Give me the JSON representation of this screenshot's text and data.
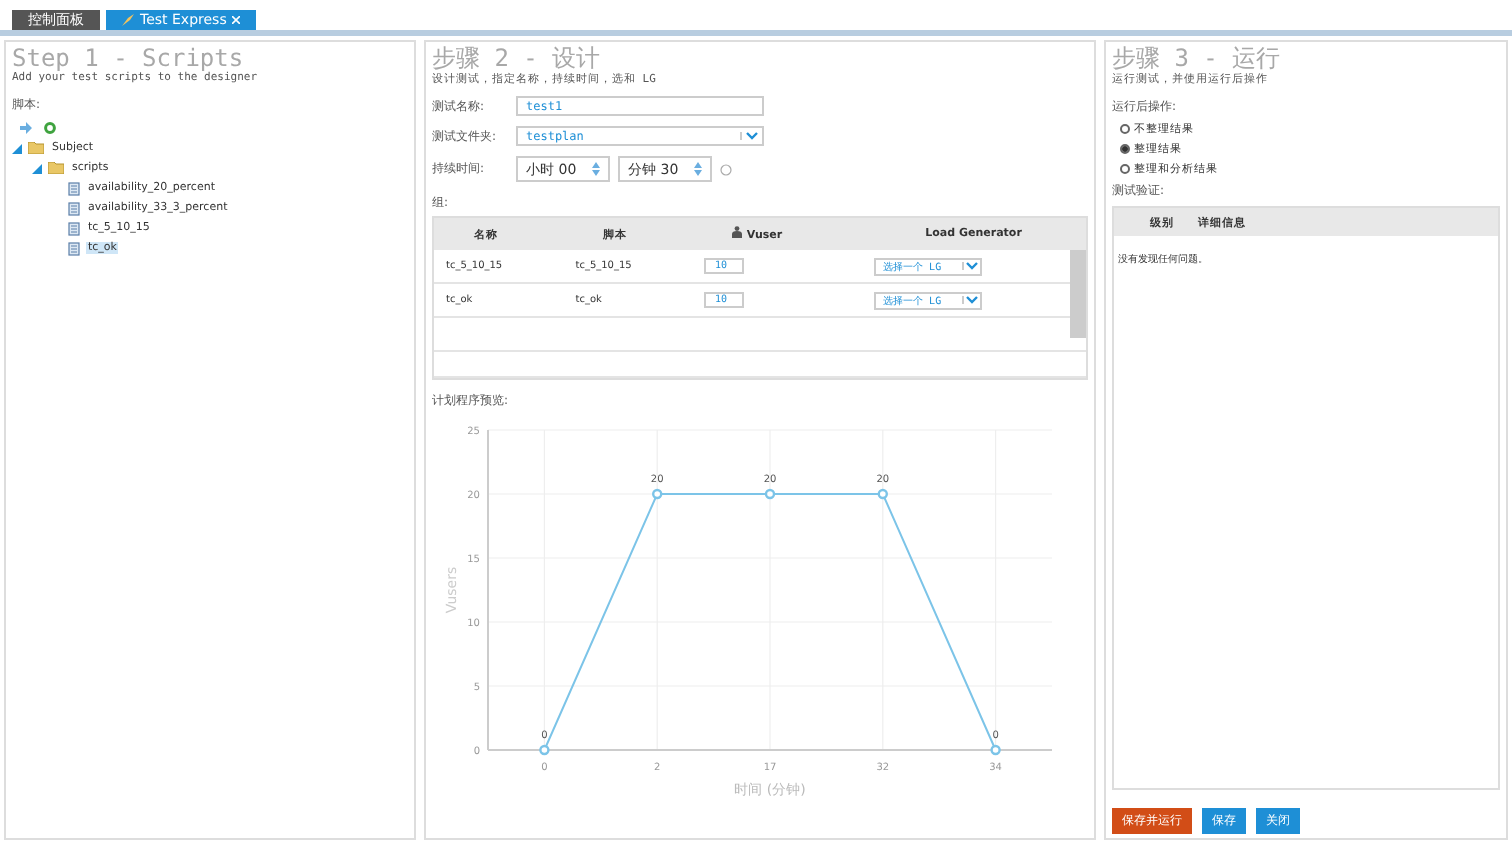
{
  "tabs": [
    {
      "label": "控制面板",
      "selected": false,
      "closable": false
    },
    {
      "label": "Test Express",
      "selected": true,
      "closable": true
    }
  ],
  "step1": {
    "title": "Step 1 - Scripts",
    "subtitle": "Add your test scripts to the designer",
    "scripts_label": "脚本:",
    "tree": [
      {
        "label": "Subject",
        "kind": "folder",
        "expanded": true,
        "selected": false,
        "children": [
          {
            "label": "scripts",
            "kind": "folder",
            "expanded": true,
            "selected": false,
            "children": [
              {
                "label": "availability_20_percent",
                "kind": "script",
                "selected": false
              },
              {
                "label": "availability_33_3_percent",
                "kind": "script",
                "selected": false
              },
              {
                "label": "tc_5_10_15",
                "kind": "script",
                "selected": false
              },
              {
                "label": "tc_ok",
                "kind": "script",
                "selected": true
              }
            ]
          }
        ]
      }
    ]
  },
  "step2": {
    "title": "步骤 2 - 设计",
    "subtitle": "设计测试，指定名称，持续时间，选和 LG",
    "name_label": "测试名称:",
    "name_value": "test1",
    "folder_label": "测试文件夹:",
    "folder_value": "testplan",
    "duration_label": "持续时间:",
    "hours_label": "小时",
    "hours_value": "00",
    "minutes_label": "分钟",
    "minutes_value": "30",
    "group_label": "组:",
    "table": {
      "columns": [
        "名称",
        "脚本",
        "Vuser",
        "Load Generator"
      ],
      "rows": [
        {
          "name": "tc_5_10_15",
          "script": "tc_5_10_15",
          "vusers": "10",
          "lg": "选择一个 LG"
        },
        {
          "name": "tc_ok",
          "script": "tc_ok",
          "vusers": "10",
          "lg": "选择一个 LG"
        }
      ]
    },
    "chart_label": "计划程序预览:",
    "chart_data": {
      "type": "line",
      "xlabel": "时间 (分钟)",
      "ylabel": "Vusers",
      "categories": [
        "0",
        "2",
        "17",
        "32",
        "34"
      ],
      "series": [
        {
          "color": "#7cc4e8",
          "marker": "circle",
          "values": [
            0,
            20,
            20,
            20,
            0
          ]
        }
      ],
      "ylim": [
        0,
        25
      ],
      "yticks": [
        0,
        5,
        10,
        15,
        20,
        25
      ],
      "grid": true,
      "data_labels": true
    }
  },
  "step3": {
    "title": "步骤 3 - 运行",
    "subtitle": "运行测试，并使用运行后操作",
    "post_run_label": "运行后操作:",
    "options": [
      {
        "label": "不整理结果",
        "selected": false
      },
      {
        "label": "整理结果",
        "selected": true
      },
      {
        "label": "整理和分析结果",
        "selected": false
      }
    ],
    "validation_label": "测试验证:",
    "validation_columns": [
      "级别",
      "详细信息"
    ],
    "validation_message": "没有发现任何问题。"
  },
  "buttons": [
    {
      "label": "保存并运行",
      "kind": "primary"
    },
    {
      "label": "保存",
      "kind": "secondary"
    },
    {
      "label": "关闭",
      "kind": "secondary"
    }
  ]
}
